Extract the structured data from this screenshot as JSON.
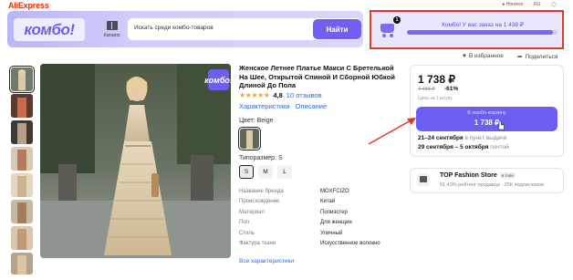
{
  "topbar": {
    "logo": "AliExpress",
    "city": "Ногинск",
    "lang": "RU"
  },
  "header": {
    "brand": "комбо!",
    "catalog_label": "Каталог",
    "search_placeholder": "Искать среди комбо-товаров",
    "search_button": "Найти",
    "combo_status": "Комбо! У вас заказ на 1 438 ₽",
    "cart_count": "1",
    "combo_progress": 0.97
  },
  "actions": {
    "favorites": "В избранное",
    "share": "Поделиться"
  },
  "product": {
    "title": "Женское Летнее Платье Макси С Бретелькой На Шее, Открытой Спиной И Сборной Юбкой Длиной До Пола",
    "rating": "4,8",
    "reviews": "10 отзывов",
    "tabs": [
      "Характеристики",
      "Описание"
    ],
    "image_badge": "комбо!",
    "color_label": "Цвет: Beige",
    "size_label": "Типоразмер: S",
    "sizes": [
      "S",
      "M",
      "L"
    ],
    "specs": [
      {
        "key": "Название бренда",
        "value": "MOXFCIZO"
      },
      {
        "key": "Происхождение",
        "value": "Китай"
      },
      {
        "key": "Материал",
        "value": "Полиэстер"
      },
      {
        "key": "Пол",
        "value": "Для женщин"
      },
      {
        "key": "Стиль",
        "value": "Уличный"
      },
      {
        "key": "Фактура ткани",
        "value": "Искусственное волокно"
      }
    ],
    "all_specs_link": "Все характеристики"
  },
  "price_card": {
    "price": "1 738 ₽",
    "old_price": "4 458 ₽",
    "discount": "-61%",
    "per_unit": "Цена за 1 штуку",
    "combo_label": "В комбо-корзину",
    "combo_price": "1 738 ₽",
    "delivery_1_date": "21–24 сентября",
    "delivery_1_where": "в пункт выдачи",
    "delivery_2_date": "29 сентября – 5 октября",
    "delivery_2_where": "почтой"
  },
  "seller": {
    "name": "TOP Fashion Store",
    "badge": "в топе",
    "stats": "91,43% рейтинг продавца · 25К подписчиков"
  },
  "colors": {
    "accent": "#6d5ef2",
    "highlight": "#e3382a",
    "brand_red": "#e62e04",
    "link": "#2d6bdb",
    "star": "#f5a623"
  }
}
